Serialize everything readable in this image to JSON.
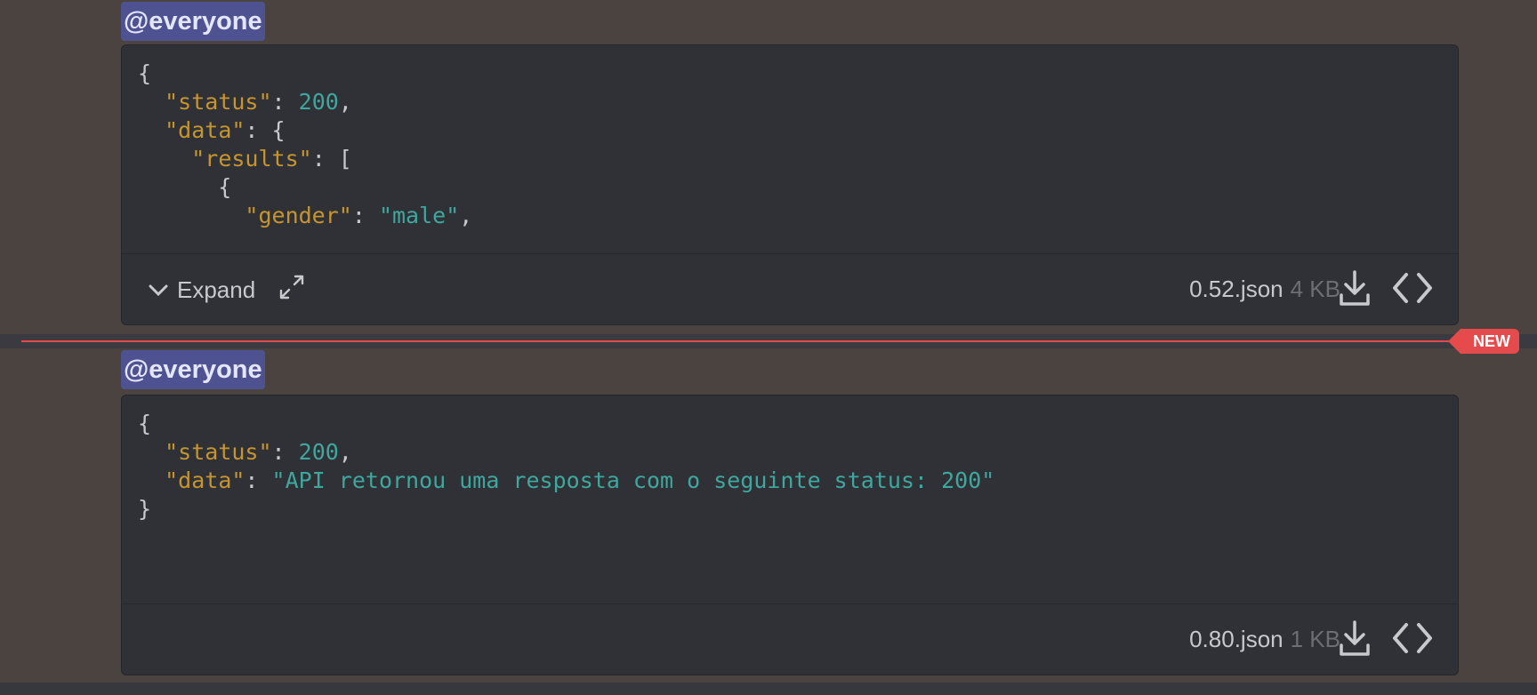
{
  "messages": [
    {
      "mention": "@everyone",
      "code_lines": [
        [
          {
            "t": "p",
            "v": "{"
          }
        ],
        [
          {
            "t": "p",
            "v": "  "
          },
          {
            "t": "k",
            "v": "\"status\""
          },
          {
            "t": "p",
            "v": ": "
          },
          {
            "t": "n",
            "v": "200"
          },
          {
            "t": "p",
            "v": ","
          }
        ],
        [
          {
            "t": "p",
            "v": "  "
          },
          {
            "t": "k",
            "v": "\"data\""
          },
          {
            "t": "p",
            "v": ": {"
          }
        ],
        [
          {
            "t": "p",
            "v": "    "
          },
          {
            "t": "k",
            "v": "\"results\""
          },
          {
            "t": "p",
            "v": ": ["
          }
        ],
        [
          {
            "t": "p",
            "v": "      {"
          }
        ],
        [
          {
            "t": "p",
            "v": "        "
          },
          {
            "t": "k",
            "v": "\"gender\""
          },
          {
            "t": "p",
            "v": ": "
          },
          {
            "t": "s",
            "v": "\"male\""
          },
          {
            "t": "p",
            "v": ","
          }
        ]
      ],
      "expand_label": "Expand",
      "filename": "0.52.json",
      "filesize": "4 KB",
      "has_expand": true
    },
    {
      "mention": "@everyone",
      "code_lines": [
        [
          {
            "t": "p",
            "v": "{"
          }
        ],
        [
          {
            "t": "p",
            "v": "  "
          },
          {
            "t": "k",
            "v": "\"status\""
          },
          {
            "t": "p",
            "v": ": "
          },
          {
            "t": "n",
            "v": "200"
          },
          {
            "t": "p",
            "v": ","
          }
        ],
        [
          {
            "t": "p",
            "v": "  "
          },
          {
            "t": "k",
            "v": "\"data\""
          },
          {
            "t": "p",
            "v": ": "
          },
          {
            "t": "s",
            "v": "\"API retornou uma resposta com o seguinte status: 200\""
          }
        ],
        [
          {
            "t": "p",
            "v": "}"
          }
        ]
      ],
      "filename": "0.80.json",
      "filesize": "1 KB",
      "has_expand": false
    }
  ],
  "divider": {
    "badge": "NEW"
  },
  "icons": {
    "expand": "chevron-down-icon",
    "fullscreen": "fullscreen-icon",
    "download": "download-icon",
    "view_code": "code-icon"
  },
  "colors": {
    "mention_bg": "#4f5290",
    "json_key": "#c7952f",
    "json_value": "#3fa79d",
    "new_badge": "#e54b4d"
  }
}
